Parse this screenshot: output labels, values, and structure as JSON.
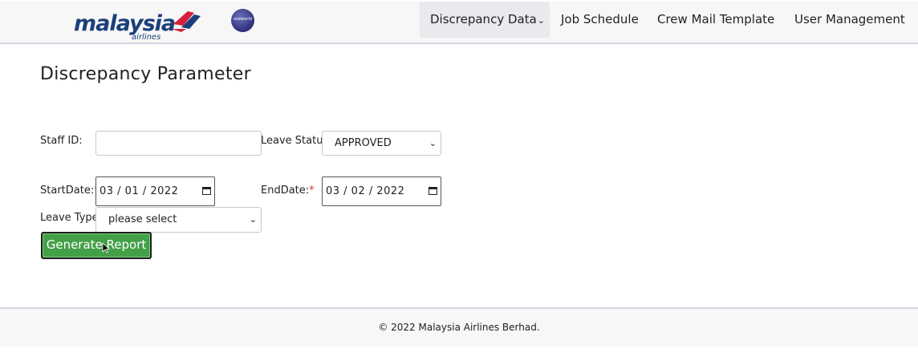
{
  "navbar": {
    "brand": {
      "name": "malaysia",
      "subtitle": "airlines",
      "logo_icon": "malaysia-airlines-kite-logo",
      "alliance_badge": "oneworld"
    },
    "items": [
      {
        "label": "Discrepancy Data",
        "has_dropdown": true,
        "active": true
      },
      {
        "label": "Job Schedule"
      },
      {
        "label": "Crew Mail Template"
      },
      {
        "label": "User Management"
      }
    ]
  },
  "page": {
    "title": "Discrepancy Parameter"
  },
  "form": {
    "staff_id": {
      "label": "Staff ID:",
      "value": "",
      "placeholder": ""
    },
    "leave_status": {
      "label": "Leave Status:",
      "value": "APPROVED"
    },
    "start_date": {
      "label": "StartDate:",
      "required_mark": "*",
      "value": "03 / 01 / 2022"
    },
    "end_date": {
      "label": "EndDate:",
      "required_mark": "*",
      "value": "03 / 02 / 2022"
    },
    "leave_type": {
      "label": "Leave Type:",
      "value": "please select"
    },
    "generate_button": "Generate Report"
  },
  "footer": {
    "copyright": "© 2022 Malaysia Airlines Berhad."
  },
  "colors": {
    "brand_blue": "#1b3f7a",
    "brand_red": "#d6203a",
    "button_green": "#43a047",
    "required_red": "#d23b3b"
  }
}
